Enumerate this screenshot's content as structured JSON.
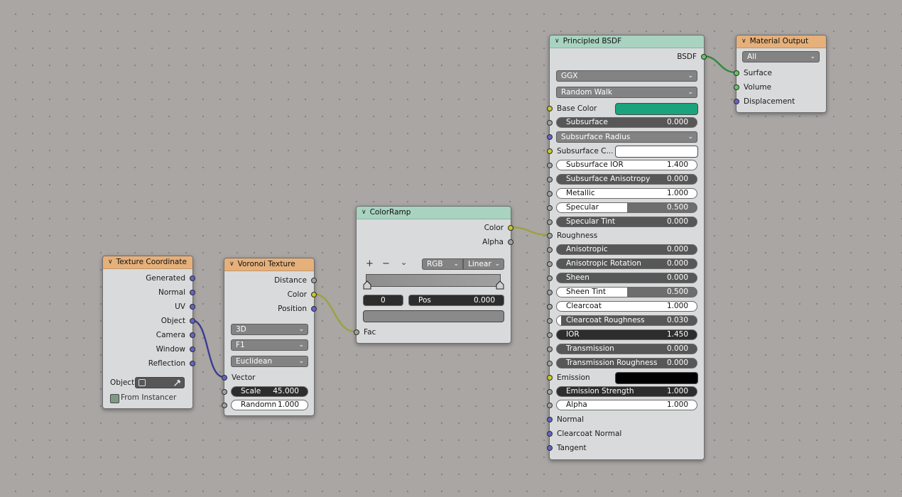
{
  "texture_coordinate": {
    "title": "Texture Coordinate",
    "outputs": [
      "Generated",
      "Normal",
      "UV",
      "Object",
      "Camera",
      "Window",
      "Reflection"
    ],
    "object_label": "Object:",
    "from_instancer": "From Instancer"
  },
  "voronoi": {
    "title": "Voronoi Texture",
    "outputs": [
      "Distance",
      "Color",
      "Position"
    ],
    "dropdowns": [
      "3D",
      "F1",
      "Euclidean"
    ],
    "vector_label": "Vector",
    "scale": {
      "label": "Scale",
      "value": "45.000"
    },
    "randomness": {
      "label": "Randomn",
      "value": "1.000"
    }
  },
  "colorramp": {
    "title": "ColorRamp",
    "outputs": [
      "Color",
      "Alpha"
    ],
    "plus": "+",
    "minus": "−",
    "menu": "⌄",
    "mode": "RGB",
    "interp": "Linear",
    "index": "0",
    "pos": {
      "label": "Pos",
      "value": "0.000"
    },
    "fac_label": "Fac"
  },
  "bsdf": {
    "title": "Principled BSDF",
    "output": "BSDF",
    "distribution": "GGX",
    "subsurface_method": "Random Walk",
    "base_color_label": "Base Color",
    "subsurface_color_label": "Subsurface C...",
    "subsurface_radius_label": "Subsurface Radius",
    "emission_label": "Emission",
    "colors": {
      "base_color": "#1aa37d",
      "subsurface_color": "#ffffff",
      "emission": "#000000"
    },
    "fields": {
      "subsurface": {
        "label": "Subsurface",
        "value": "0.000"
      },
      "subsurface_ior": {
        "label": "Subsurface IOR",
        "value": "1.400"
      },
      "subsurface_anisotropy": {
        "label": "Subsurface Anisotropy",
        "value": "0.000"
      },
      "metallic": {
        "label": "Metallic",
        "value": "1.000"
      },
      "specular": {
        "label": "Specular",
        "value": "0.500"
      },
      "specular_tint": {
        "label": "Specular Tint",
        "value": "0.000"
      },
      "anisotropic": {
        "label": "Anisotropic",
        "value": "0.000"
      },
      "anisotropic_rotation": {
        "label": "Anisotropic Rotation",
        "value": "0.000"
      },
      "sheen": {
        "label": "Sheen",
        "value": "0.000"
      },
      "sheen_tint": {
        "label": "Sheen Tint",
        "value": "0.500"
      },
      "clearcoat": {
        "label": "Clearcoat",
        "value": "1.000"
      },
      "clearcoat_roughness": {
        "label": "Clearcoat Roughness",
        "value": "0.030"
      },
      "ior": {
        "label": "IOR",
        "value": "1.450"
      },
      "transmission": {
        "label": "Transmission",
        "value": "0.000"
      },
      "transmission_roughness": {
        "label": "Transmission Roughness",
        "value": "0.000"
      },
      "emission_strength": {
        "label": "Emission Strength",
        "value": "1.000"
      },
      "alpha": {
        "label": "Alpha",
        "value": "1.000"
      }
    },
    "roughness_label": "Roughness",
    "normal_label": "Normal",
    "clearcoat_normal_label": "Clearcoat Normal",
    "tangent_label": "Tangent"
  },
  "material_output": {
    "title": "Material Output",
    "target": "All",
    "inputs": [
      "Surface",
      "Volume",
      "Displacement"
    ]
  }
}
